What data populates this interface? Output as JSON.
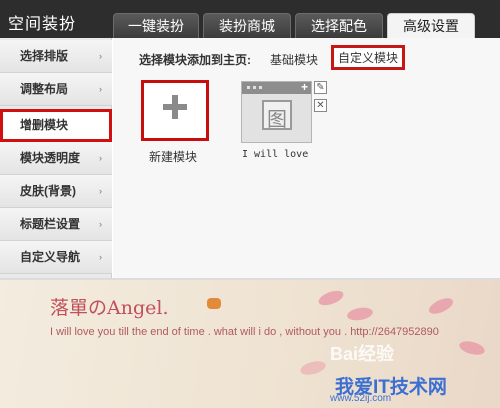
{
  "app_title": "空间装扮",
  "tabs": [
    {
      "label": "一键装扮"
    },
    {
      "label": "装扮商城"
    },
    {
      "label": "选择配色"
    },
    {
      "label": "高级设置"
    }
  ],
  "sidebar": {
    "items": [
      {
        "label": "选择排版"
      },
      {
        "label": "调整布局"
      },
      {
        "label": "增删模块"
      },
      {
        "label": "模块透明度"
      },
      {
        "label": "皮肤(背景)"
      },
      {
        "label": "标题栏设置"
      },
      {
        "label": "自定义导航"
      }
    ],
    "arrow": "›"
  },
  "main": {
    "section_label": "选择模块添加到主页:",
    "opt_basic": "基础模块",
    "opt_custom": "自定义模块",
    "new_caption": "新建模块",
    "template_caption": "I will love",
    "template_glyph": "图",
    "edit_glyph": "✎",
    "close_glyph": "✕"
  },
  "banner": {
    "title": "落單のAngel.",
    "subtitle": "I will love you till the end of time . what will i do , without you .   http://2647952890",
    "watermark_main": "Bai经验",
    "watermark_site": "我爱IT技术网",
    "watermark_url": "www.52ij.com"
  },
  "colors": {
    "accent_red": "#c80d0d",
    "topbar": "#2d2d2d",
    "banner_text": "#c0505a"
  }
}
